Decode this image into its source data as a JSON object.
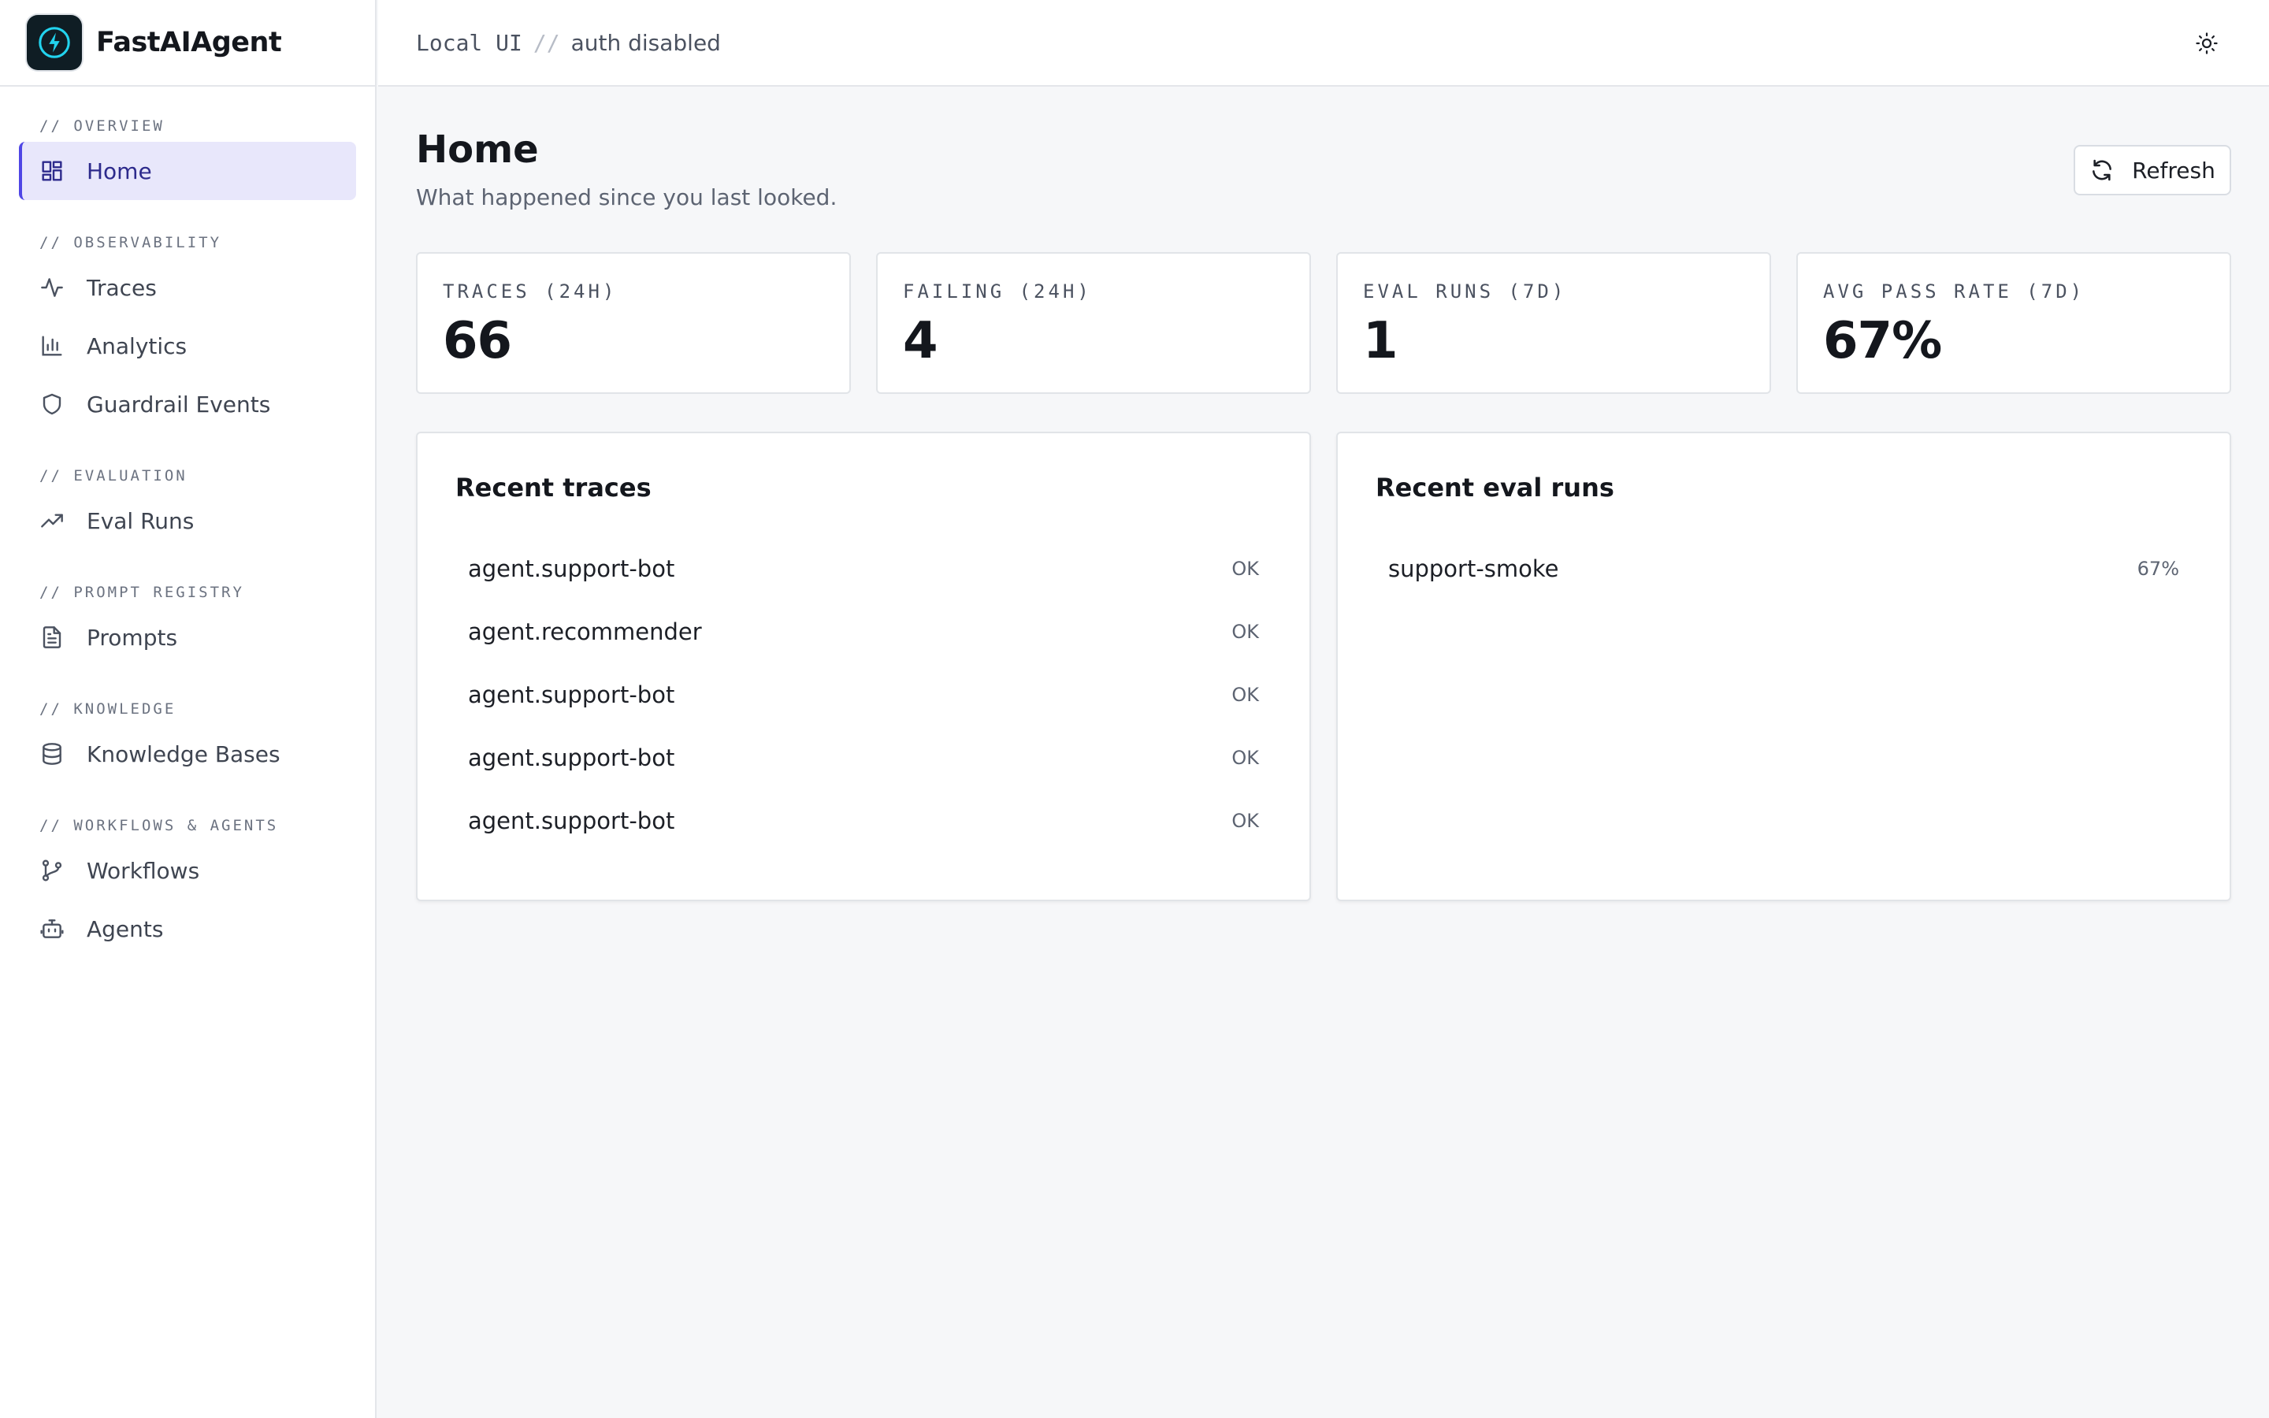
{
  "brand": {
    "name": "FastAIAgent"
  },
  "sidebar": {
    "sections": [
      {
        "label": "// OVERVIEW",
        "items": [
          {
            "label": "Home",
            "icon": "dashboard-icon",
            "active": true
          }
        ]
      },
      {
        "label": "// OBSERVABILITY",
        "items": [
          {
            "label": "Traces",
            "icon": "activity-icon"
          },
          {
            "label": "Analytics",
            "icon": "bar-chart-icon"
          },
          {
            "label": "Guardrail Events",
            "icon": "shield-icon"
          }
        ]
      },
      {
        "label": "// EVALUATION",
        "items": [
          {
            "label": "Eval Runs",
            "icon": "trending-up-icon"
          }
        ]
      },
      {
        "label": "// PROMPT REGISTRY",
        "items": [
          {
            "label": "Prompts",
            "icon": "file-text-icon"
          }
        ]
      },
      {
        "label": "// KNOWLEDGE",
        "items": [
          {
            "label": "Knowledge Bases",
            "icon": "database-icon"
          }
        ]
      },
      {
        "label": "// WORKFLOWS & AGENTS",
        "items": [
          {
            "label": "Workflows",
            "icon": "git-branch-icon"
          },
          {
            "label": "Agents",
            "icon": "bot-icon"
          }
        ]
      }
    ]
  },
  "topbar": {
    "mode": "Local UI",
    "separator": "//",
    "auth": "auth disabled",
    "theme_icon": "sun-icon"
  },
  "page": {
    "title": "Home",
    "subtitle": "What happened since you last looked.",
    "refresh_label": "Refresh"
  },
  "stats": [
    {
      "label": "TRACES (24H)",
      "value": "66"
    },
    {
      "label": "FAILING (24H)",
      "value": "4"
    },
    {
      "label": "EVAL RUNS (7D)",
      "value": "1"
    },
    {
      "label": "AVG PASS RATE (7D)",
      "value": "67%"
    }
  ],
  "recent_traces": {
    "title": "Recent traces",
    "rows": [
      {
        "name": "agent.support-bot",
        "status": "OK"
      },
      {
        "name": "agent.recommender",
        "status": "OK"
      },
      {
        "name": "agent.support-bot",
        "status": "OK"
      },
      {
        "name": "agent.support-bot",
        "status": "OK"
      },
      {
        "name": "agent.support-bot",
        "status": "OK"
      }
    ]
  },
  "recent_eval_runs": {
    "title": "Recent eval runs",
    "rows": [
      {
        "name": "support-smoke",
        "status": "67%"
      }
    ]
  },
  "colors": {
    "accent": "#4f46e5",
    "active_bg": "#e8e7fb",
    "logo_bg": "#0f1d24",
    "logo_bolt": "#22d3ee"
  }
}
